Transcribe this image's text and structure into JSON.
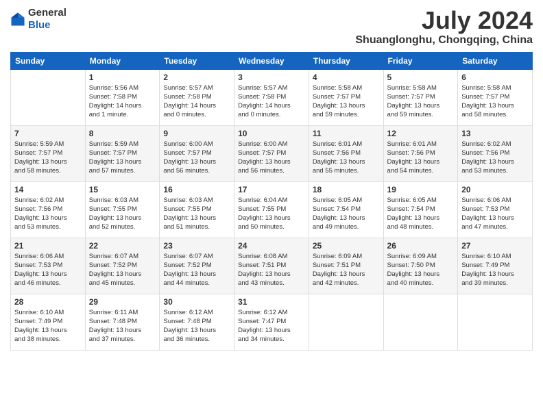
{
  "header": {
    "logo": {
      "general": "General",
      "blue": "Blue"
    },
    "title": "July 2024",
    "location": "Shuanglonghu, Chongqing, China"
  },
  "calendar": {
    "days_of_week": [
      "Sunday",
      "Monday",
      "Tuesday",
      "Wednesday",
      "Thursday",
      "Friday",
      "Saturday"
    ],
    "weeks": [
      [
        {
          "day": "",
          "content": ""
        },
        {
          "day": "1",
          "content": "Sunrise: 5:56 AM\nSunset: 7:58 PM\nDaylight: 14 hours\nand 1 minute."
        },
        {
          "day": "2",
          "content": "Sunrise: 5:57 AM\nSunset: 7:58 PM\nDaylight: 14 hours\nand 0 minutes."
        },
        {
          "day": "3",
          "content": "Sunrise: 5:57 AM\nSunset: 7:58 PM\nDaylight: 14 hours\nand 0 minutes."
        },
        {
          "day": "4",
          "content": "Sunrise: 5:58 AM\nSunset: 7:57 PM\nDaylight: 13 hours\nand 59 minutes."
        },
        {
          "day": "5",
          "content": "Sunrise: 5:58 AM\nSunset: 7:57 PM\nDaylight: 13 hours\nand 59 minutes."
        },
        {
          "day": "6",
          "content": "Sunrise: 5:58 AM\nSunset: 7:57 PM\nDaylight: 13 hours\nand 58 minutes."
        }
      ],
      [
        {
          "day": "7",
          "content": "Sunrise: 5:59 AM\nSunset: 7:57 PM\nDaylight: 13 hours\nand 58 minutes."
        },
        {
          "day": "8",
          "content": "Sunrise: 5:59 AM\nSunset: 7:57 PM\nDaylight: 13 hours\nand 57 minutes."
        },
        {
          "day": "9",
          "content": "Sunrise: 6:00 AM\nSunset: 7:57 PM\nDaylight: 13 hours\nand 56 minutes."
        },
        {
          "day": "10",
          "content": "Sunrise: 6:00 AM\nSunset: 7:57 PM\nDaylight: 13 hours\nand 56 minutes."
        },
        {
          "day": "11",
          "content": "Sunrise: 6:01 AM\nSunset: 7:56 PM\nDaylight: 13 hours\nand 55 minutes."
        },
        {
          "day": "12",
          "content": "Sunrise: 6:01 AM\nSunset: 7:56 PM\nDaylight: 13 hours\nand 54 minutes."
        },
        {
          "day": "13",
          "content": "Sunrise: 6:02 AM\nSunset: 7:56 PM\nDaylight: 13 hours\nand 53 minutes."
        }
      ],
      [
        {
          "day": "14",
          "content": "Sunrise: 6:02 AM\nSunset: 7:56 PM\nDaylight: 13 hours\nand 53 minutes."
        },
        {
          "day": "15",
          "content": "Sunrise: 6:03 AM\nSunset: 7:55 PM\nDaylight: 13 hours\nand 52 minutes."
        },
        {
          "day": "16",
          "content": "Sunrise: 6:03 AM\nSunset: 7:55 PM\nDaylight: 13 hours\nand 51 minutes."
        },
        {
          "day": "17",
          "content": "Sunrise: 6:04 AM\nSunset: 7:55 PM\nDaylight: 13 hours\nand 50 minutes."
        },
        {
          "day": "18",
          "content": "Sunrise: 6:05 AM\nSunset: 7:54 PM\nDaylight: 13 hours\nand 49 minutes."
        },
        {
          "day": "19",
          "content": "Sunrise: 6:05 AM\nSunset: 7:54 PM\nDaylight: 13 hours\nand 48 minutes."
        },
        {
          "day": "20",
          "content": "Sunrise: 6:06 AM\nSunset: 7:53 PM\nDaylight: 13 hours\nand 47 minutes."
        }
      ],
      [
        {
          "day": "21",
          "content": "Sunrise: 6:06 AM\nSunset: 7:53 PM\nDaylight: 13 hours\nand 46 minutes."
        },
        {
          "day": "22",
          "content": "Sunrise: 6:07 AM\nSunset: 7:52 PM\nDaylight: 13 hours\nand 45 minutes."
        },
        {
          "day": "23",
          "content": "Sunrise: 6:07 AM\nSunset: 7:52 PM\nDaylight: 13 hours\nand 44 minutes."
        },
        {
          "day": "24",
          "content": "Sunrise: 6:08 AM\nSunset: 7:51 PM\nDaylight: 13 hours\nand 43 minutes."
        },
        {
          "day": "25",
          "content": "Sunrise: 6:09 AM\nSunset: 7:51 PM\nDaylight: 13 hours\nand 42 minutes."
        },
        {
          "day": "26",
          "content": "Sunrise: 6:09 AM\nSunset: 7:50 PM\nDaylight: 13 hours\nand 40 minutes."
        },
        {
          "day": "27",
          "content": "Sunrise: 6:10 AM\nSunset: 7:49 PM\nDaylight: 13 hours\nand 39 minutes."
        }
      ],
      [
        {
          "day": "28",
          "content": "Sunrise: 6:10 AM\nSunset: 7:49 PM\nDaylight: 13 hours\nand 38 minutes."
        },
        {
          "day": "29",
          "content": "Sunrise: 6:11 AM\nSunset: 7:48 PM\nDaylight: 13 hours\nand 37 minutes."
        },
        {
          "day": "30",
          "content": "Sunrise: 6:12 AM\nSunset: 7:48 PM\nDaylight: 13 hours\nand 36 minutes."
        },
        {
          "day": "31",
          "content": "Sunrise: 6:12 AM\nSunset: 7:47 PM\nDaylight: 13 hours\nand 34 minutes."
        },
        {
          "day": "",
          "content": ""
        },
        {
          "day": "",
          "content": ""
        },
        {
          "day": "",
          "content": ""
        }
      ]
    ]
  }
}
